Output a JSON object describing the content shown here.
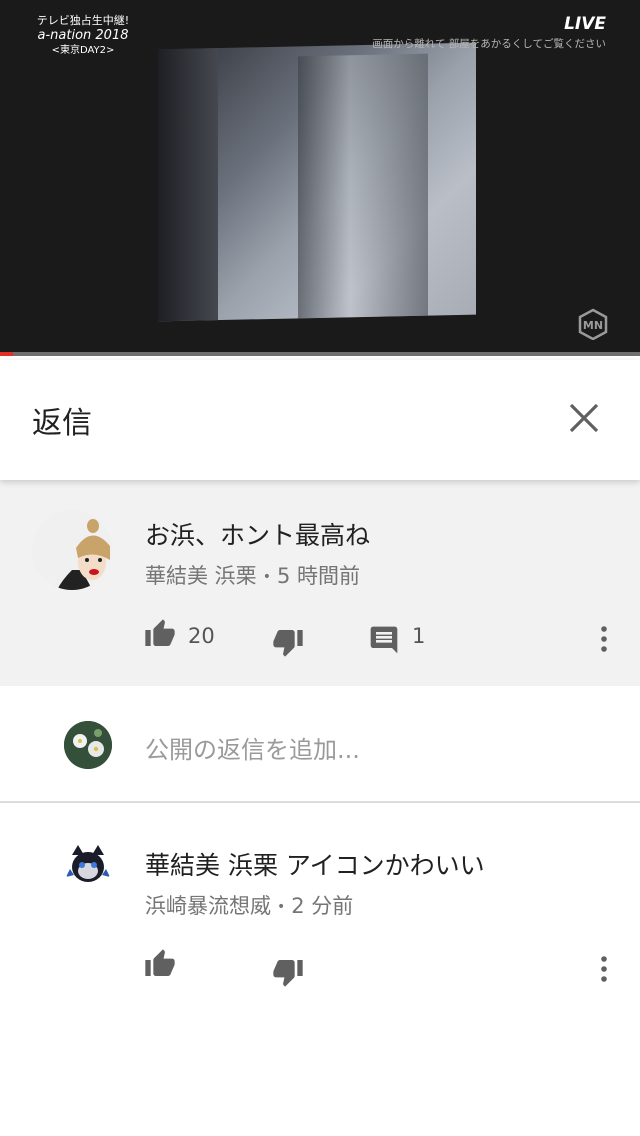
{
  "video": {
    "show_title_line1": "テレビ独占生中継!",
    "show_title_line2": "a-nation 2018",
    "show_title_line3": "<東京DAY2>",
    "live_label": "LIVE",
    "notice": "画面から離れて 部屋をあかるくしてご覧ください",
    "progress": 0.02
  },
  "header": {
    "title": "返信",
    "close_icon": "close-icon"
  },
  "comment": {
    "text": "お浜、ホント最高ね",
    "author": "華結美 浜栗",
    "separator": "•",
    "time": "5 時間前",
    "like_count": "20",
    "reply_count": "1"
  },
  "reply_input": {
    "placeholder": "公開の返信を追加..."
  },
  "reply": {
    "text": "華結美 浜栗 アイコンかわいい",
    "author": "浜崎暴流想威",
    "separator": "•",
    "time": "2 分前"
  },
  "colors": {
    "accent": "#e52d27",
    "highlight_bg": "#f2f2f2",
    "icon": "#606060"
  }
}
